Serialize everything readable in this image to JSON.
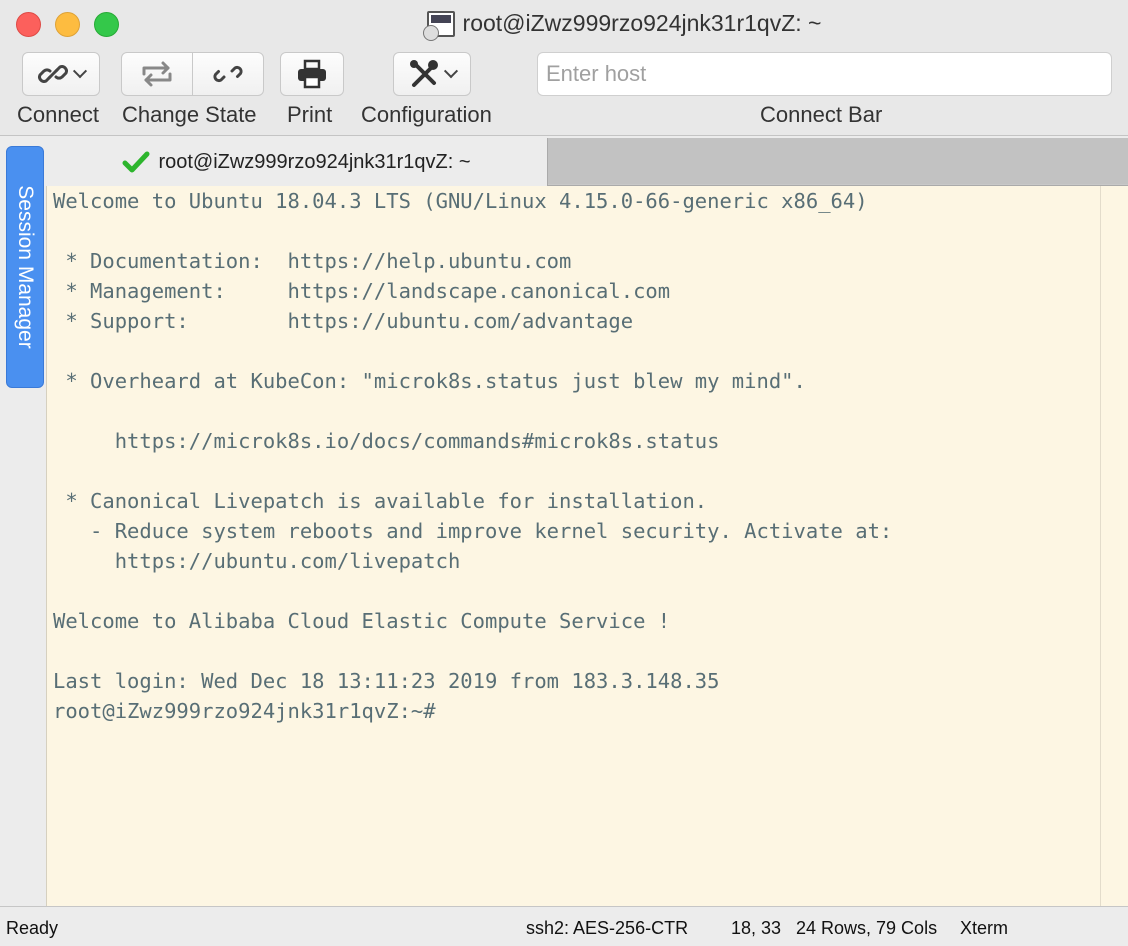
{
  "window": {
    "title": "root@iZwz999rzo924jnk31r1qvZ: ~"
  },
  "toolbar": {
    "connect_label": "Connect",
    "change_state_label": "Change State",
    "print_label": "Print",
    "configuration_label": "Configuration",
    "host_placeholder": "Enter host",
    "host_value": "",
    "connect_bar_label": "Connect Bar"
  },
  "sidebar": {
    "session_manager_label": "Session Manager"
  },
  "tab": {
    "title": "root@iZwz999rzo924jnk31r1qvZ: ~",
    "status_icon": "checkmark-icon",
    "status_color": "#2db52d"
  },
  "terminal": {
    "lines": [
      "Welcome to Ubuntu 18.04.3 LTS (GNU/Linux 4.15.0-66-generic x86_64)",
      "",
      " * Documentation:  https://help.ubuntu.com",
      " * Management:     https://landscape.canonical.com",
      " * Support:        https://ubuntu.com/advantage",
      "",
      " * Overheard at KubeCon: \"microk8s.status just blew my mind\".",
      "",
      "     https://microk8s.io/docs/commands#microk8s.status",
      "",
      " * Canonical Livepatch is available for installation.",
      "   - Reduce system reboots and improve kernel security. Activate at:",
      "     https://ubuntu.com/livepatch",
      "",
      "Welcome to Alibaba Cloud Elastic Compute Service !",
      "",
      "Last login: Wed Dec 18 13:11:23 2019 from 183.3.148.35",
      "root@iZwz999rzo924jnk31r1qvZ:~#"
    ],
    "background": "#fdf6e3",
    "foreground": "#586e75"
  },
  "status": {
    "state": "Ready",
    "cipher": "ssh2: AES-256-CTR",
    "cursor": "18, 33",
    "size": "24 Rows, 79 Cols",
    "emulation": "Xterm"
  }
}
